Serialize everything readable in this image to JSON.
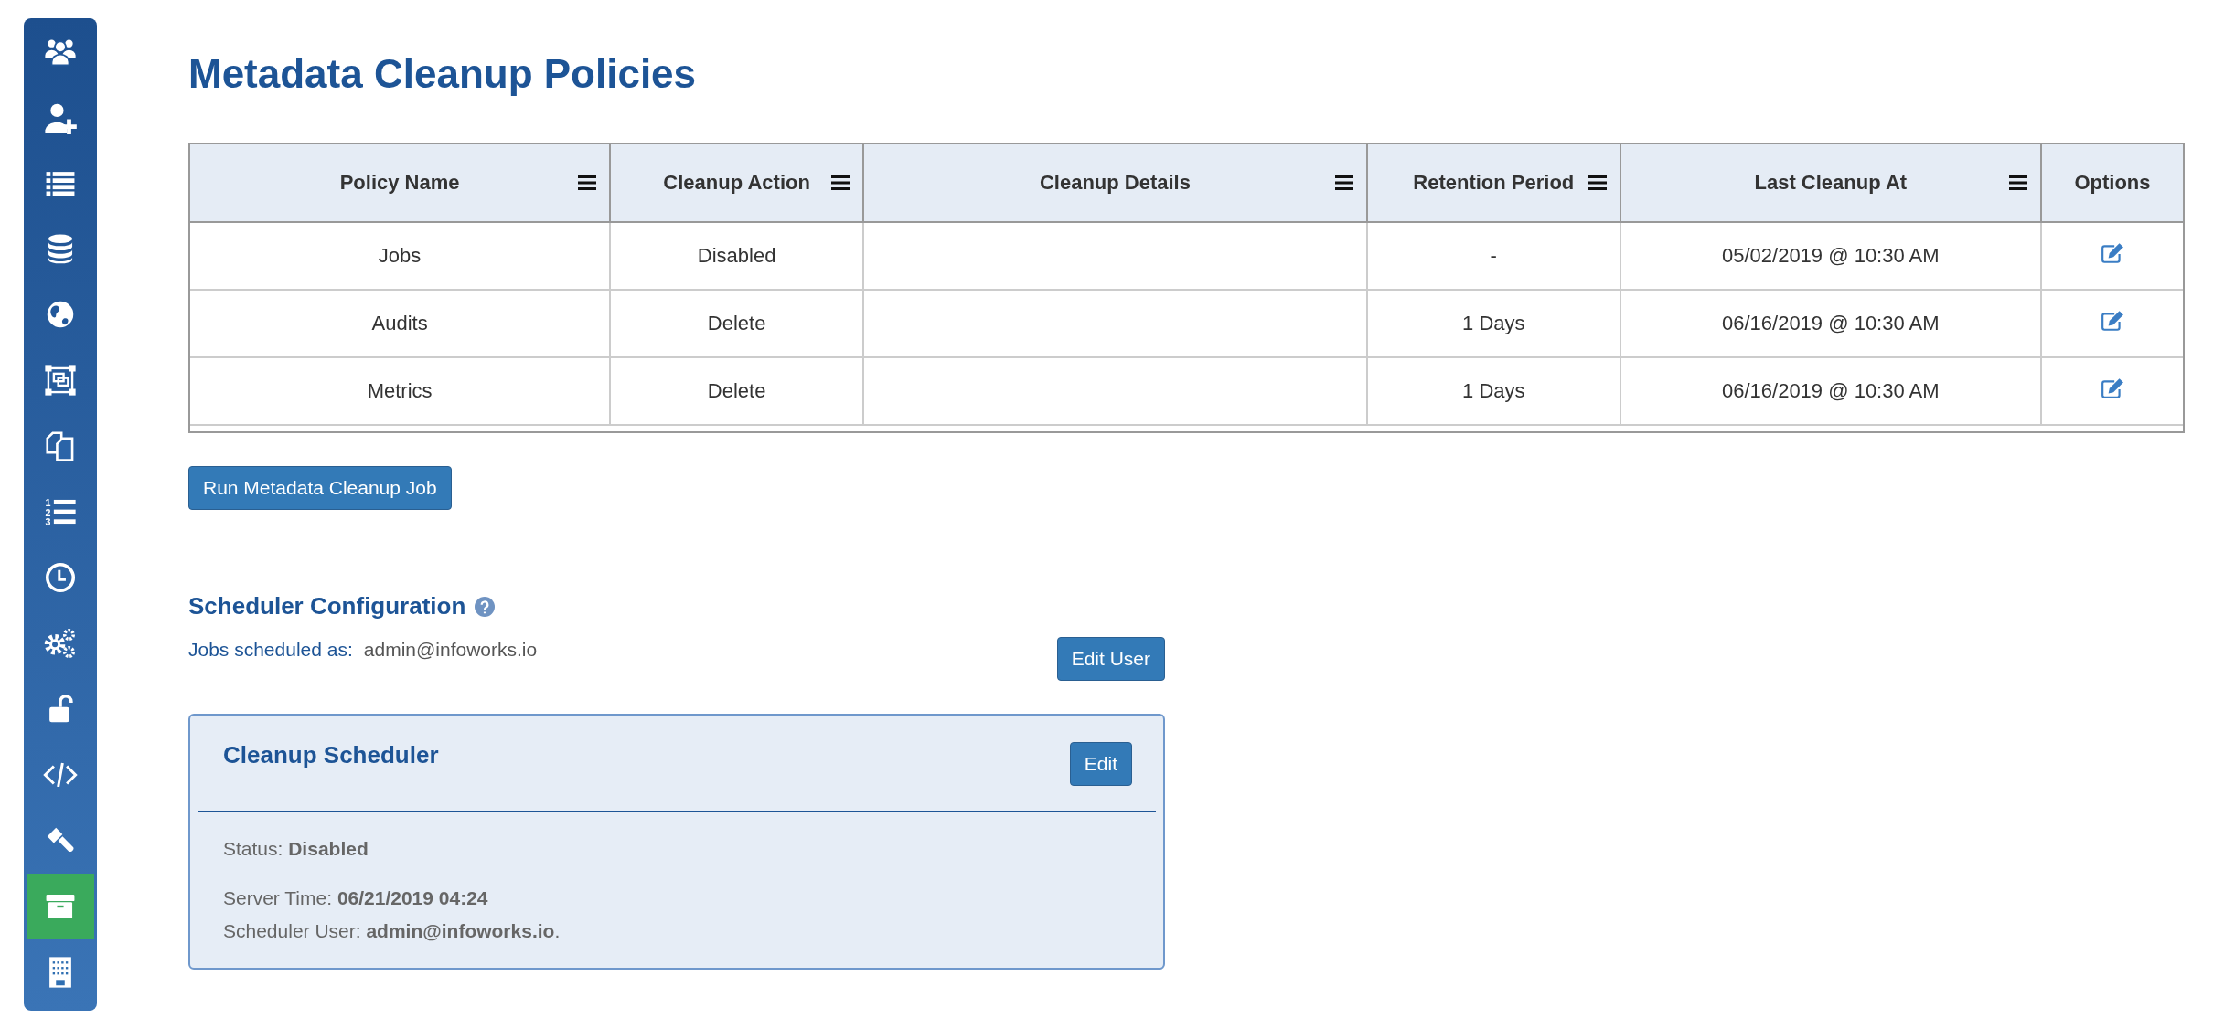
{
  "sidebar": {
    "items": [
      {
        "selected": false
      },
      {
        "selected": false
      },
      {
        "selected": false
      },
      {
        "selected": false
      },
      {
        "selected": false
      },
      {
        "selected": false
      },
      {
        "selected": false
      },
      {
        "selected": false,
        "numerals": [
          "1",
          "2",
          "3"
        ]
      },
      {
        "selected": false
      },
      {
        "selected": false
      },
      {
        "selected": false
      },
      {
        "selected": false
      },
      {
        "selected": false
      },
      {
        "selected": true
      },
      {
        "selected": false
      }
    ]
  },
  "title": "Metadata Cleanup Policies",
  "table": {
    "columns": [
      {
        "label": "Policy Name",
        "has_menu": true
      },
      {
        "label": "Cleanup Action",
        "has_menu": true
      },
      {
        "label": "Cleanup Details",
        "has_menu": true
      },
      {
        "label": "Retention Period",
        "has_menu": true
      },
      {
        "label": "Last Cleanup At",
        "has_menu": true
      },
      {
        "label": "Options",
        "has_menu": false
      }
    ],
    "rows": [
      {
        "cells": [
          "Jobs",
          "Disabled",
          "",
          "-",
          "05/02/2019 @ 10:30 AM"
        ]
      },
      {
        "cells": [
          "Audits",
          "Delete",
          "",
          "1 Days",
          "06/16/2019 @ 10:30 AM"
        ]
      },
      {
        "cells": [
          "Metrics",
          "Delete",
          "",
          "1 Days",
          "06/16/2019 @ 10:30 AM"
        ]
      }
    ]
  },
  "run_button": "Run Metadata Cleanup Job",
  "scheduler": {
    "heading": "Scheduler Configuration",
    "scheduled_label": "Jobs scheduled as:",
    "scheduled_value": "admin@infoworks.io",
    "edit_user_button": "Edit User",
    "card": {
      "title": "Cleanup Scheduler",
      "edit_button": "Edit",
      "status": "Status: **Disabled**",
      "server_time": "Server Time:  **06/21/2019 04:24**",
      "scheduler_user": "Scheduler User:  **admin@infoworks.io**."
    }
  }
}
